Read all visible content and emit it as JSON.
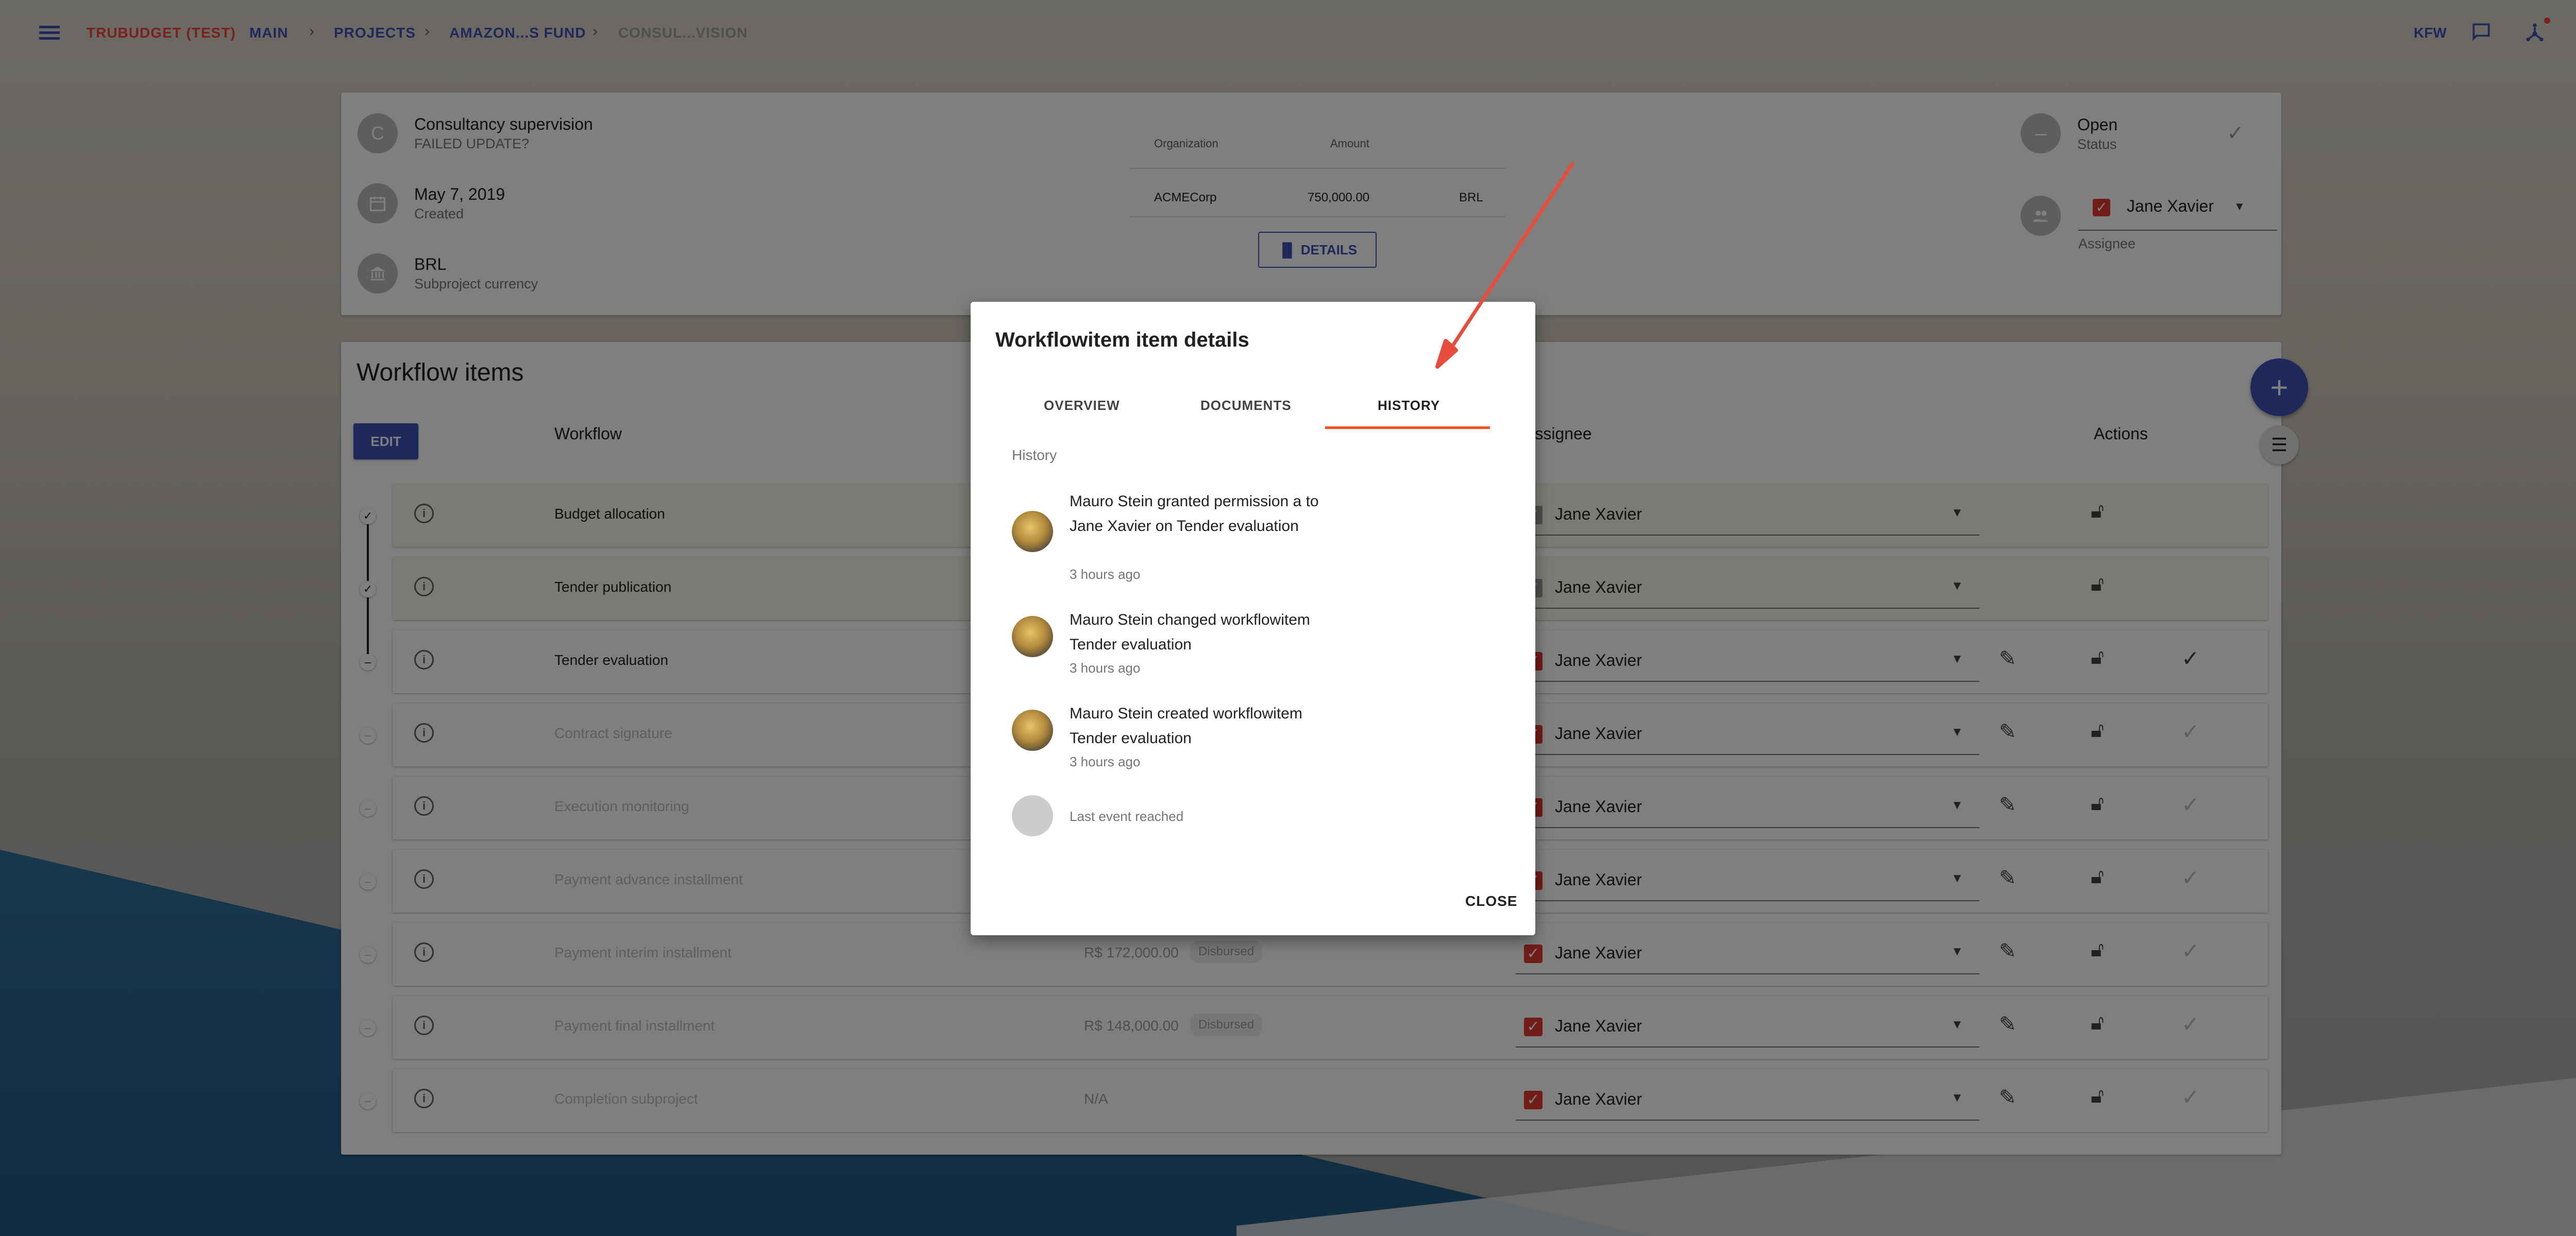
{
  "breadcrumb": {
    "app": "TRUBUDGET (TEST)",
    "main": "MAIN",
    "projects": "PROJECTS",
    "project": "AMAZON...S FUND",
    "subproject": "CONSUL...VISION"
  },
  "topbar": {
    "org": "KFW"
  },
  "subproject": {
    "avatar_letter": "C",
    "name": "Consultancy supervision",
    "desc": "FAILED UPDATE?",
    "date": "May 7, 2019",
    "date_label": "Created",
    "currency": "BRL",
    "currency_label": "Subproject currency",
    "table": {
      "headers": [
        "Organization",
        "Amount"
      ],
      "row": {
        "org": "ACMECorp",
        "amount": "750,000.00",
        "cur": "BRL"
      }
    },
    "details_button": "DETAILS",
    "status": "Open",
    "status_label": "Status",
    "assignee": "Jane Xavier",
    "assignee_label": "Assignee"
  },
  "workflow": {
    "title": "Workflow items",
    "edit_button": "EDIT",
    "col_workflow": "Workflow",
    "col_assignee": "Assignee",
    "col_actions": "Actions",
    "items": [
      {
        "name": "Budget allocation",
        "amount": "",
        "badge": "",
        "assignee": "Jane Xavier"
      },
      {
        "name": "Tender publication",
        "amount": "",
        "badge": "",
        "assignee": "Jane Xavier"
      },
      {
        "name": "Tender evaluation",
        "amount": "",
        "badge": "",
        "assignee": "Jane Xavier"
      },
      {
        "name": "Contract signature",
        "amount": "",
        "badge": "",
        "assignee": "Jane Xavier"
      },
      {
        "name": "Execution monitoring",
        "amount": "",
        "badge": "",
        "assignee": "Jane Xavier"
      },
      {
        "name": "Payment advance installment",
        "amount": "",
        "badge": "",
        "assignee": "Jane Xavier"
      },
      {
        "name": "Payment interim installment",
        "amount": "R$ 172,000.00",
        "badge": "Disbursed",
        "assignee": "Jane Xavier"
      },
      {
        "name": "Payment final installment",
        "amount": "R$ 148,000.00",
        "badge": "Disbursed",
        "assignee": "Jane Xavier"
      },
      {
        "name": "Completion subproject",
        "amount": "N/A",
        "badge": "",
        "assignee": "Jane Xavier"
      }
    ]
  },
  "dialog": {
    "title": "Workflowitem item details",
    "tabs": [
      "OVERVIEW",
      "DOCUMENTS",
      "HISTORY"
    ],
    "active_tab": "HISTORY",
    "history_label": "History",
    "events": [
      {
        "text": "Mauro Stein granted permission a  to Jane Xavier on Tender evaluation",
        "time": "3 hours ago"
      },
      {
        "text": "Mauro Stein changed workflowitem Tender evaluation",
        "time": "3 hours ago"
      },
      {
        "text": "Mauro Stein created workflowitem Tender evaluation",
        "time": "3 hours ago"
      }
    ],
    "last_event": "Last event reached",
    "close_button": "CLOSE"
  },
  "colors": {
    "primary": "#3f51b5",
    "accent": "#f4511e",
    "brand_red": "#f44336",
    "annotation_arrow": "#e74c3c"
  }
}
